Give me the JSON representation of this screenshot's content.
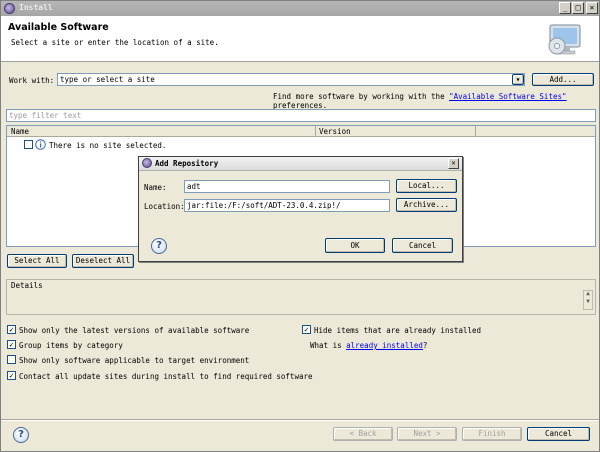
{
  "window": {
    "title": "Install",
    "minimize": "_",
    "maximize": "□",
    "close": "✕"
  },
  "header": {
    "title": "Available Software",
    "subtitle": "Select a site or enter the location of a site."
  },
  "work_with": {
    "label": "Work with:",
    "value": "type or select a site",
    "dropdown": "▾",
    "add_button": "Add..."
  },
  "find_more": {
    "prefix": "Find more software by working with the",
    "link": "\"Available Software Sites\"",
    "suffix": "preferences."
  },
  "filter": {
    "placeholder": "type filter text"
  },
  "table": {
    "columns": [
      "Name",
      "Version"
    ],
    "rows": [
      {
        "name": "There is no site selected.",
        "checked": false
      }
    ]
  },
  "buttons": {
    "select_all": "Select All",
    "deselect_all": "Deselect All"
  },
  "details": {
    "label": "Details"
  },
  "options": {
    "left": [
      {
        "label": "Show only the latest versions of available software",
        "checked": true
      },
      {
        "label": "Group items by category",
        "checked": true
      },
      {
        "label": "Show only software applicable to target environment",
        "checked": false
      },
      {
        "label": "Contact all update sites during install to find required software",
        "checked": true
      }
    ],
    "right": [
      {
        "label": "Hide items that are already installed",
        "checked": true
      }
    ],
    "what_is_prefix": "What is",
    "what_is_link": "already installed",
    "what_is_suffix": "?"
  },
  "footer": {
    "back": "< Back",
    "next": "Next >",
    "finish": "Finish",
    "cancel": "Cancel",
    "help": "?"
  },
  "dialog": {
    "title": "Add Repository",
    "close": "✕",
    "name_label": "Name:",
    "name_value": "adt",
    "location_label": "Location:",
    "location_value": "jar:file:/F:/soft/ADT-23.0.4.zip!/",
    "local_button": "Local...",
    "archive_button": "Archive...",
    "ok_button": "OK",
    "cancel_button": "Cancel",
    "help": "?"
  },
  "colors": {
    "link": "#0000ee",
    "window_bg": "#ece9d8",
    "header_bg": "#ffffff"
  }
}
